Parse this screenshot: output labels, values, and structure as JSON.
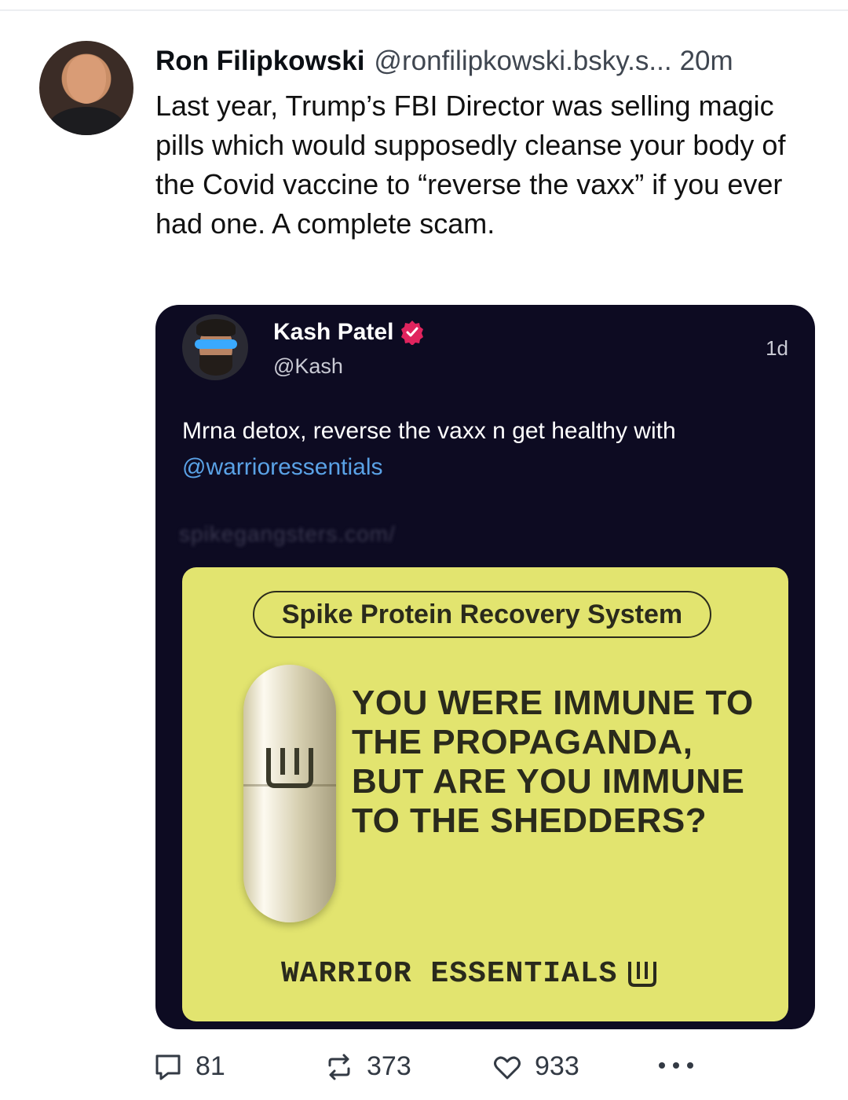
{
  "post": {
    "author_name": "Ron Filipkowski",
    "handle": "@ronfilipkowski.bsky.s...",
    "timestamp": "20m",
    "text": "Last year, Trump’s FBI Director was selling magic pills which would supposedly cleanse your body of the Covid vaccine to “reverse the vaxx” if you ever had one. A complete scam."
  },
  "quoted": {
    "author_name": "Kash Patel",
    "handle": "@Kash",
    "timestamp": "1d",
    "text_before": "Mrna detox, reverse the vaxx n get healthy with",
    "mention": "@warrioressentials",
    "blurred_link": "spikegangsters.com/",
    "promo": {
      "tag": "Spike Protein Recovery System",
      "headline": "YOU WERE IMMUNE TO THE PROPAGANDA, BUT ARE YOU IMMUNE TO THE SHEDDERS?",
      "brand": "WARRIOR ESSENTIALS",
      "background_color": "#e2e46f"
    }
  },
  "actions": {
    "replies": "81",
    "reposts": "373",
    "likes": "933",
    "icons": [
      "reply-icon",
      "repost-icon",
      "like-icon",
      "more-icon"
    ]
  },
  "colors": {
    "embed_bg": "#0d0b22",
    "mention": "#5aa2e6",
    "verified": "#e0245e"
  }
}
